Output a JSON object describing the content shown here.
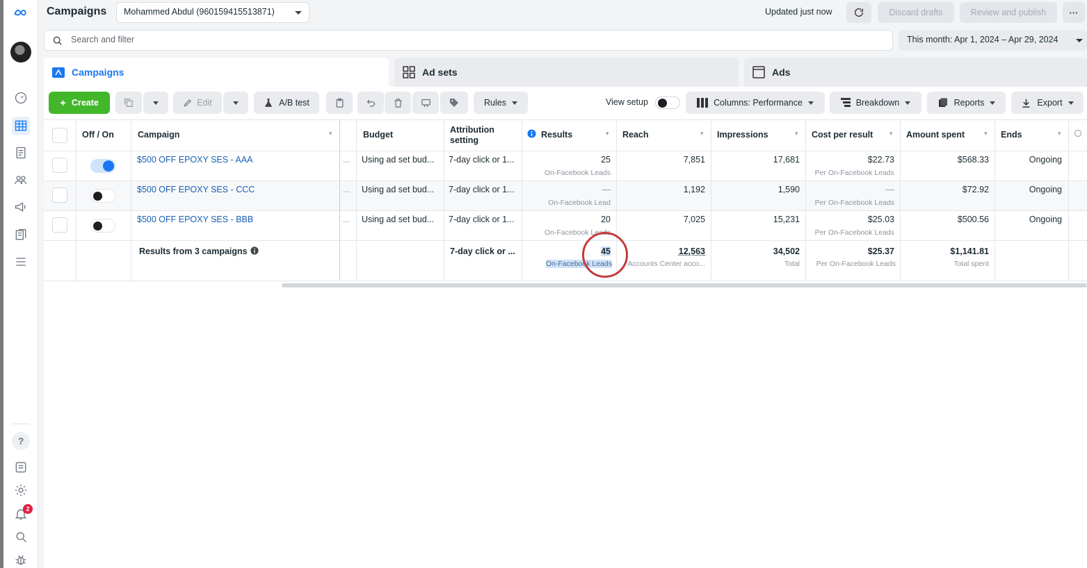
{
  "topbar": {
    "title": "Campaigns",
    "account": "Mohammed Abdul (960159415513871)",
    "updated": "Updated just now",
    "discard": "Discard drafts",
    "publish": "Review and publish",
    "more": "···"
  },
  "search": {
    "placeholder": "Search and filter"
  },
  "date_range": "This month: Apr 1, 2024 – Apr 29, 2024",
  "tabs": [
    {
      "label": "Campaigns"
    },
    {
      "label": "Ad sets"
    },
    {
      "label": "Ads"
    }
  ],
  "toolbar": {
    "create": "Create",
    "edit": "Edit",
    "ab_test": "A/B test",
    "rules": "Rules",
    "view_setup": "View setup",
    "columns": "Columns: Performance",
    "breakdown": "Breakdown",
    "reports": "Reports",
    "export": "Export"
  },
  "table": {
    "headers": {
      "off_on": "Off / On",
      "campaign": "Campaign",
      "budget": "Budget",
      "attribution": "Attribution setting",
      "results": "Results",
      "reach": "Reach",
      "impressions": "Impressions",
      "cost_per_result": "Cost per result",
      "amount_spent": "Amount spent",
      "ends": "Ends"
    },
    "rows": [
      {
        "on": true,
        "campaign": "$500 OFF EPOXY SES - AAA",
        "dots": "...",
        "budget": "Using ad set bud...",
        "attribution": "7-day click or 1...",
        "results": "25",
        "results_sub": "On-Facebook Leads",
        "reach": "7,851",
        "impressions": "17,681",
        "cpr": "$22.73",
        "cpr_sub": "Per On-Facebook Leads",
        "spent": "$568.33",
        "ends": "Ongoing"
      },
      {
        "on": false,
        "campaign": "$500 OFF EPOXY SES - CCC",
        "dots": "...",
        "budget": "Using ad set bud...",
        "attribution": "7-day click or 1...",
        "results": "—",
        "results_sub": "On-Facebook Lead",
        "reach": "1,192",
        "impressions": "1,590",
        "cpr": "—",
        "cpr_sub": "Per On-Facebook Leads",
        "spent": "$72.92",
        "ends": "Ongoing"
      },
      {
        "on": false,
        "campaign": "$500 OFF EPOXY SES - BBB",
        "dots": "...",
        "budget": "Using ad set bud...",
        "attribution": "7-day click or 1...",
        "results": "20",
        "results_sub": "On-Facebook Leads",
        "reach": "7,025",
        "impressions": "15,231",
        "cpr": "$25.03",
        "cpr_sub": "Per On-Facebook Leads",
        "spent": "$500.56",
        "ends": "Ongoing"
      }
    ],
    "totals": {
      "label": "Results from 3 campaigns",
      "attribution": "7-day click or ...",
      "results": "45",
      "results_sub": "On-Facebook Leads",
      "reach": "12,563",
      "reach_sub": "Accounts Center acco...",
      "impressions": "34,502",
      "impressions_sub": "Total",
      "cpr": "$25.37",
      "cpr_sub": "Per On-Facebook Leads",
      "spent": "$1,141.81",
      "spent_sub": "Total spent"
    }
  },
  "notifications": {
    "count": "2"
  },
  "colors": {
    "accent": "#1877f2",
    "create": "#42b72a",
    "annotation": "#c43a3a"
  }
}
